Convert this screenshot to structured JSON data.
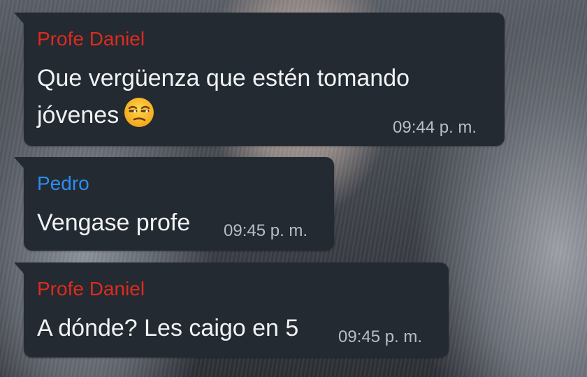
{
  "messages": [
    {
      "sender": "Profe Daniel",
      "sender_color": "#e02a1f",
      "text_line1": "Que vergüenza que estén tomando",
      "text_line2": "jóvenes",
      "emoji": "unamused-face-icon",
      "time": "09:44 p. m."
    },
    {
      "sender": "Pedro",
      "sender_color": "#2d8cf0",
      "text_line1": "Vengase profe",
      "time": "09:45 p. m."
    },
    {
      "sender": "Profe Daniel",
      "sender_color": "#e02a1f",
      "text_line1": "A dónde? Les caigo en 5",
      "time": "09:45 p. m."
    }
  ],
  "colors": {
    "bubble": "#232a31",
    "text": "#f1f3f5",
    "time": "#b7bec6"
  }
}
